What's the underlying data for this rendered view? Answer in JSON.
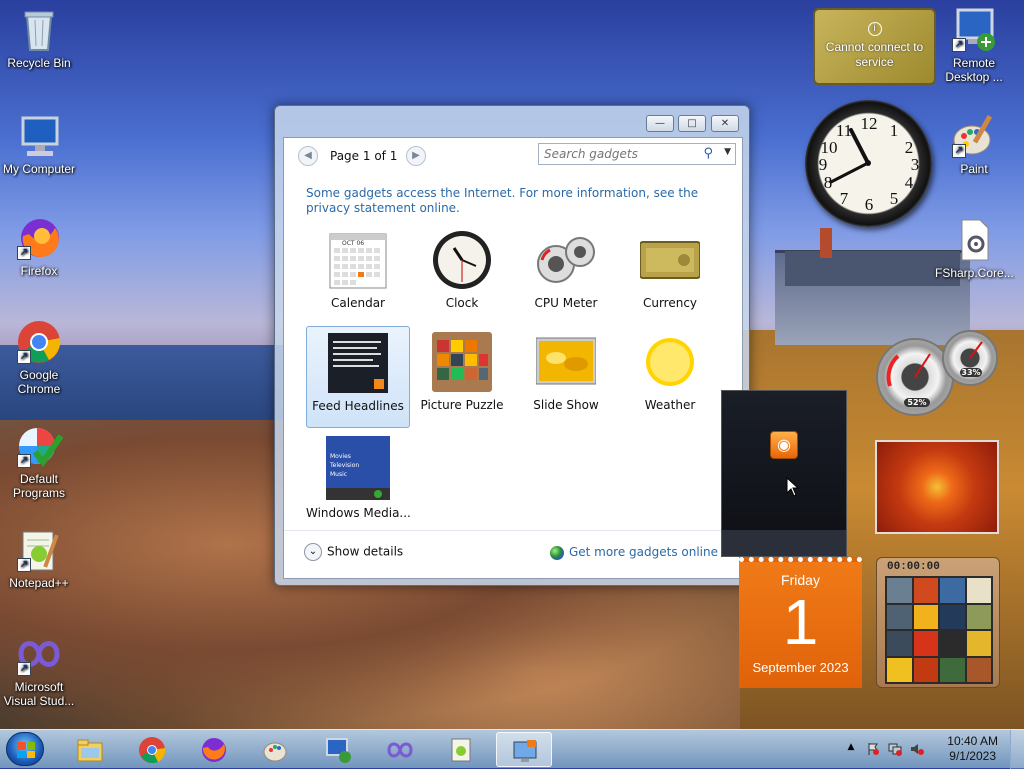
{
  "desktop": {
    "icons": [
      {
        "label": "Recycle Bin"
      },
      {
        "label": "My Computer"
      },
      {
        "label": "Firefox"
      },
      {
        "label": "Google Chrome"
      },
      {
        "label": "Default Programs"
      },
      {
        "label": "Notepad++"
      },
      {
        "label": "Microsoft Visual Stud..."
      },
      {
        "label": "Remote Desktop ..."
      },
      {
        "label": "Paint"
      },
      {
        "label": "FSharp.Core..."
      }
    ]
  },
  "gallery": {
    "controls": {
      "minimize": "—",
      "maximize": "□",
      "close": "✕"
    },
    "page_label": "Page 1 of 1",
    "search_placeholder": "Search gadgets",
    "info_text": "Some gadgets access the Internet.  For more information, see the privacy statement online.",
    "gadgets": [
      {
        "label": "Calendar"
      },
      {
        "label": "Clock"
      },
      {
        "label": "CPU Meter"
      },
      {
        "label": "Currency"
      },
      {
        "label": "Feed Headlines",
        "selected": true
      },
      {
        "label": "Picture Puzzle"
      },
      {
        "label": "Slide Show"
      },
      {
        "label": "Weather"
      },
      {
        "label": "Windows Media..."
      }
    ],
    "calendar_thumb_month": "OCT 06",
    "wmc_thumb_lines": [
      "Movies",
      "Television",
      "Music"
    ],
    "show_details": "Show details",
    "get_more": "Get more gadgets online"
  },
  "sidebar": {
    "currency_text": "Cannot connect to service",
    "currency_info_icon": "i",
    "clock_numbers": [
      "12",
      "1",
      "2",
      "3",
      "4",
      "5",
      "6",
      "7",
      "8",
      "9",
      "10",
      "11"
    ],
    "cpu": {
      "cpu_percent": "52%",
      "memory_percent": "33%"
    },
    "calendar": {
      "weekday": "Friday",
      "day": "1",
      "month_year": "September 2023"
    },
    "puzzle_timer": "00:00:00"
  },
  "taskbar": {
    "time": "10:40 AM",
    "date": "9/1/2023",
    "tray_up_arrow": "▲"
  },
  "colors": {
    "accent": "#2a6aa8",
    "calendar": "#e86a12"
  }
}
